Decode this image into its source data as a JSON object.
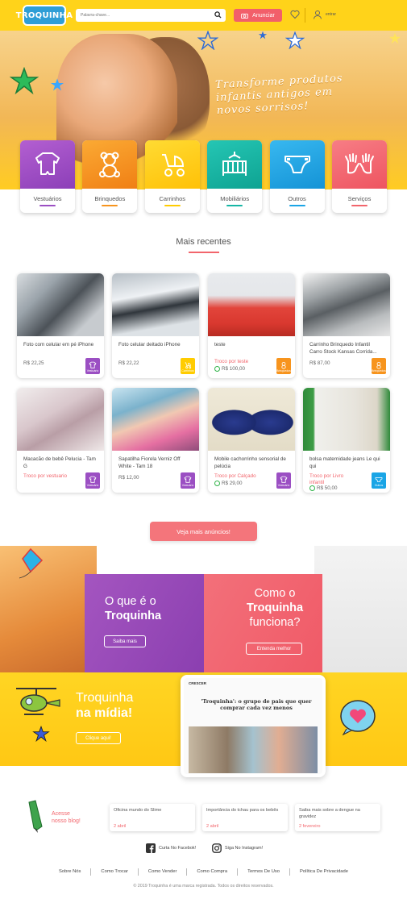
{
  "header": {
    "logo_text": "TROQUINHA",
    "search_placeholder": "Palavra-chave...",
    "anunciar_label": "Anunciar",
    "login_label": "entrar"
  },
  "hero": {
    "slogan": "Transforme produtos infantis antigos em novos sorrisos!"
  },
  "categories": [
    {
      "label": "Vestuários",
      "color": "#9b4fc3",
      "icon": "onesie-icon"
    },
    {
      "label": "Brinquedos",
      "color": "#f7941d",
      "icon": "teddy-bear-icon"
    },
    {
      "label": "Carrinhos",
      "color": "#ffcc00",
      "icon": "stroller-icon"
    },
    {
      "label": "Mobiliários",
      "color": "#16b6a5",
      "icon": "crib-icon"
    },
    {
      "label": "Outros",
      "color": "#1aa5e6",
      "icon": "diaper-icon"
    },
    {
      "label": "Serviços",
      "color": "#f2656c",
      "icon": "hands-icon"
    }
  ],
  "recent": {
    "title": "Mais recentes",
    "items": [
      {
        "title": "Foto com celular em pé iPhone",
        "price": "R$ 22,25",
        "badge": "Vestuário",
        "badge_color": "#9b4fc3"
      },
      {
        "title": "Foto celular deitado iPhone",
        "price": "R$ 22,22",
        "badge": "Carrinhos",
        "badge_color": "#ffcc00"
      },
      {
        "title": "teste",
        "trade_prefix": "Troco por",
        "trade_item": "teste",
        "price": "R$ 100,00",
        "badge": "Brinquedos",
        "badge_color": "#f7941d"
      },
      {
        "title": "Carrinho Brinquedo Infantil Carro Stock Kansas Corrida...",
        "price": "R$ 87,00",
        "badge": "Brinquedos",
        "badge_color": "#f7941d"
      },
      {
        "title": "Macacão de bebê Pelucia - Tam G",
        "trade_prefix": "Troco por",
        "trade_item": "vestuario",
        "price": "",
        "badge": "Vestuário",
        "badge_color": "#9b4fc3"
      },
      {
        "title": "Sapatilha Fiorela Verniz Off White - Tam 18",
        "price": "R$ 12,00",
        "badge": "Vestuário",
        "badge_color": "#9b4fc3"
      },
      {
        "title": "Mobile cachorrinho sensorial de pelúcia",
        "trade_prefix": "Troco por",
        "trade_item": "Calçado",
        "price": "R$ 29,00",
        "badge": "Vestuário",
        "badge_color": "#9b4fc3"
      },
      {
        "title": "bolsa maternidade jeans Le qui qui",
        "trade_prefix": "Troco por",
        "trade_item": "Livro infantil",
        "price": "R$ 50,00",
        "badge": "Outros",
        "badge_color": "#1aa5e6"
      }
    ]
  },
  "more_button": "Veja mais anúncios!",
  "promo": {
    "what_prefix": "O que é o",
    "what_bold": "Troquinha",
    "what_button": "Saiba mais",
    "how_line1": "Como o",
    "how_bold": "Troquinha",
    "how_line3": "funciona?",
    "how_button": "Entenda melhor"
  },
  "media": {
    "title_line1": "Troquinha",
    "title_bold": "na mídia!",
    "button": "Clique aqui!",
    "tablet_brand": "CRESCER",
    "tablet_headline": "'Troquinha': o grupo de pais que quer comprar cada vez menos"
  },
  "blog": {
    "title_line1": "Acesse",
    "title_line2": "nosso blog!",
    "posts": [
      {
        "title": "Oficina mundo do Slime",
        "date": "2 abril"
      },
      {
        "title": "Importância do tchau para os bebês",
        "date": "2 abril"
      },
      {
        "title": "Saiba mais sobre a dengue na gravidez",
        "date": "2 fevereiro"
      }
    ]
  },
  "social": {
    "facebook": "Curta No Facebok!",
    "instagram": "Siga No Instagram!"
  },
  "footer": {
    "links": [
      "Sobre Nós",
      "Como Trocar",
      "Como Vender",
      "Como Compra",
      "Termos De Uso",
      "Política De Privacidade"
    ],
    "copyright": "© 2019 Troquinha é uma marca registrada. Todos os direitos reservados."
  },
  "colors": {
    "accent": "#f2656c",
    "header_yellow": "#ffd31a",
    "purple": "#9b4fc3"
  }
}
